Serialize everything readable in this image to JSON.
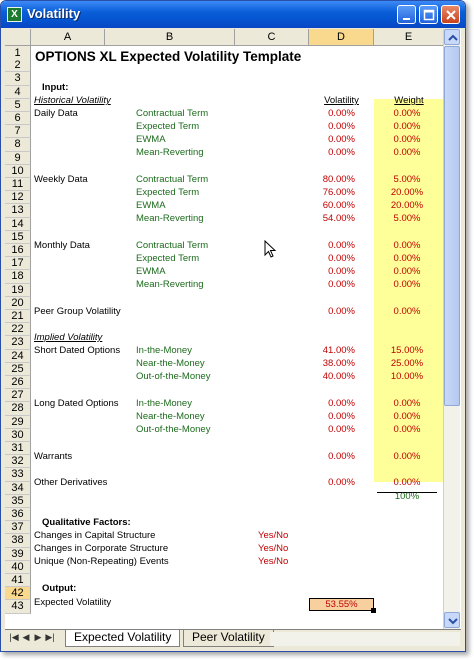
{
  "window": {
    "title": "Volatility",
    "app_icon": "excel-icon"
  },
  "columns": [
    "A",
    "B",
    "C",
    "D",
    "E"
  ],
  "rows": [
    "1",
    "2",
    "3",
    "4",
    "5",
    "6",
    "7",
    "8",
    "9",
    "10",
    "11",
    "12",
    "13",
    "14",
    "15",
    "16",
    "17",
    "18",
    "19",
    "20",
    "21",
    "22",
    "23",
    "24",
    "25",
    "26",
    "27",
    "28",
    "29",
    "30",
    "31",
    "32",
    "33",
    "34",
    "35",
    "36",
    "37",
    "38",
    "39",
    "40",
    "41",
    "42",
    "43"
  ],
  "selected_cell": "D42",
  "cells": {
    "title": "OPTIONS XL Expected Volatility Template",
    "input_label": "Input:",
    "historical_label": "Historical Volatility",
    "volatility_header": "Volatility",
    "weight_header": "Weight",
    "daily_data": "Daily Data",
    "weekly_data": "Weekly Data",
    "monthly_data": "Monthly Data",
    "peer_group": "Peer Group Volatility",
    "implied_label": "Implied Volatility",
    "short_dated": "Short Dated Options",
    "long_dated": "Long Dated Options",
    "warrants": "Warrants",
    "other_derivatives": "Other Derivatives",
    "contractual_term": "Contractual Term",
    "expected_term": "Expected Term",
    "ewma": "EWMA",
    "mean_reverting": "Mean-Reverting",
    "in_the_money": "In-the-Money",
    "near_the_money": "Near-the-Money",
    "out_of_the_money": "Out-of-the-Money",
    "weight_total": "100%",
    "qualitative_label": "Qualitative Factors:",
    "q1": "Changes in Capital Structure",
    "q2": "Changes in Corporate Structure",
    "q3": "Unique (Non-Repeating) Events",
    "yes_no": "Yes/No",
    "output_label": "Output:",
    "expected_volatility": "Expected Volatility",
    "expected_volatility_value": "53.55%"
  },
  "values": {
    "r5": {
      "vol": "0.00%",
      "w": "0.00%"
    },
    "r6": {
      "vol": "0.00%",
      "w": "0.00%"
    },
    "r7": {
      "vol": "0.00%",
      "w": "0.00%"
    },
    "r8": {
      "vol": "0.00%",
      "w": "0.00%"
    },
    "r10": {
      "vol": "80.00%",
      "w": "5.00%"
    },
    "r11": {
      "vol": "76.00%",
      "w": "20.00%"
    },
    "r12": {
      "vol": "60.00%",
      "w": "20.00%"
    },
    "r13": {
      "vol": "54.00%",
      "w": "5.00%"
    },
    "r15": {
      "vol": "0.00%",
      "w": "0.00%"
    },
    "r16": {
      "vol": "0.00%",
      "w": "0.00%"
    },
    "r17": {
      "vol": "0.00%",
      "w": "0.00%"
    },
    "r18": {
      "vol": "0.00%",
      "w": "0.00%"
    },
    "r20": {
      "vol": "0.00%",
      "w": "0.00%"
    },
    "r23": {
      "vol": "41.00%",
      "w": "15.00%"
    },
    "r24": {
      "vol": "38.00%",
      "w": "25.00%"
    },
    "r25": {
      "vol": "40.00%",
      "w": "10.00%"
    },
    "r27": {
      "vol": "0.00%",
      "w": "0.00%"
    },
    "r28": {
      "vol": "0.00%",
      "w": "0.00%"
    },
    "r29": {
      "vol": "0.00%",
      "w": "0.00%"
    },
    "r31": {
      "vol": "0.00%",
      "w": "0.00%"
    },
    "r33": {
      "vol": "0.00%",
      "w": "0.00%"
    }
  },
  "tabs": [
    {
      "label": "Expected Volatility",
      "active": true
    },
    {
      "label": "Peer Volatility",
      "active": false
    }
  ],
  "colors": {
    "title_bar": "#0554d0",
    "weight_fill": "#ffff99",
    "output_fill": "#f8d0a0",
    "value_red": "#c00000",
    "label_green": "#1d6b1d"
  }
}
